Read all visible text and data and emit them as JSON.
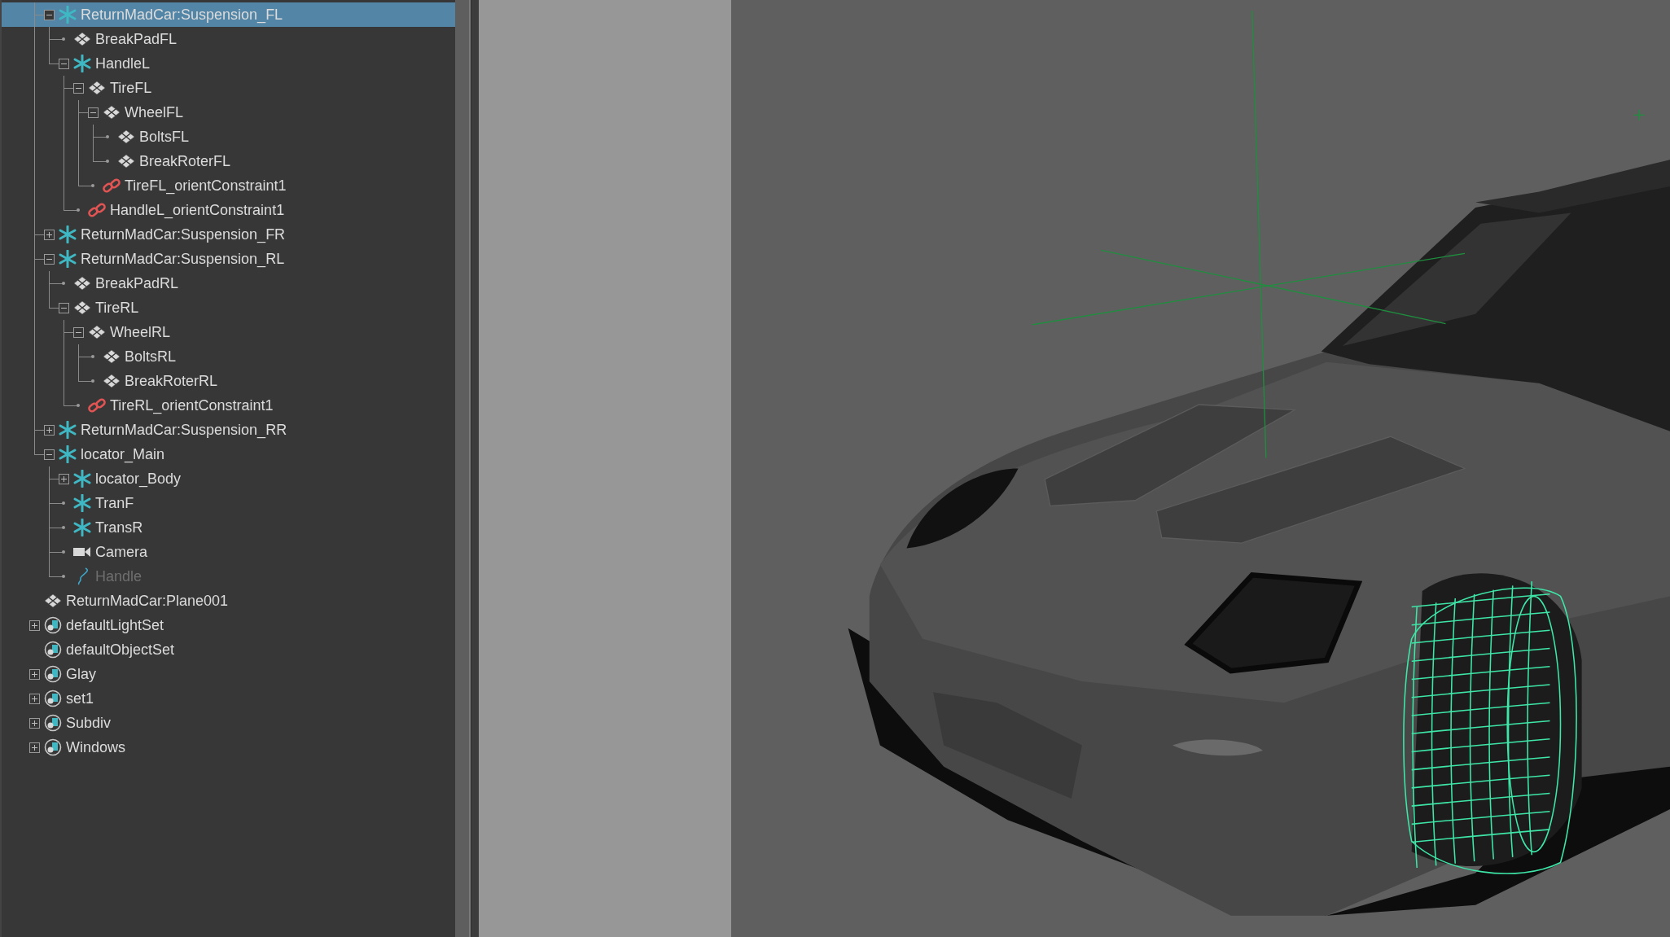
{
  "outliner": {
    "items": [
      {
        "children": [
          {
            "label": "ReturnMadCar:Suspension_FL",
            "kind": "locator",
            "expanded": true,
            "selected": true,
            "hidden": false,
            "children": [
              {
                "label": "BreakPadFL",
                "kind": "mesh",
                "selected": false,
                "hidden": false
              },
              {
                "label": "HandleL",
                "kind": "locator",
                "expanded": true,
                "selected": false,
                "hidden": false,
                "children": [
                  {
                    "label": "TireFL",
                    "kind": "mesh",
                    "expanded": true,
                    "selected": false,
                    "hidden": false,
                    "children": [
                      {
                        "label": "WheelFL",
                        "kind": "mesh",
                        "expanded": true,
                        "selected": false,
                        "hidden": false,
                        "children": [
                          {
                            "label": "BoltsFL",
                            "kind": "mesh",
                            "selected": false,
                            "hidden": false
                          },
                          {
                            "label": "BreakRoterFL",
                            "kind": "mesh",
                            "selected": false,
                            "hidden": false
                          }
                        ]
                      },
                      {
                        "label": "TireFL_orientConstraint1",
                        "kind": "constraint",
                        "selected": false,
                        "hidden": false
                      }
                    ]
                  },
                  {
                    "label": "HandleL_orientConstraint1",
                    "kind": "constraint",
                    "selected": false,
                    "hidden": false
                  }
                ]
              }
            ]
          },
          {
            "label": "ReturnMadCar:Suspension_FR",
            "kind": "locator",
            "expanded": false,
            "selected": false,
            "hidden": false
          },
          {
            "label": "ReturnMadCar:Suspension_RL",
            "kind": "locator",
            "expanded": true,
            "selected": false,
            "hidden": false,
            "children": [
              {
                "label": "BreakPadRL",
                "kind": "mesh",
                "selected": false,
                "hidden": false
              },
              {
                "label": "TireRL",
                "kind": "mesh",
                "expanded": true,
                "selected": false,
                "hidden": false,
                "children": [
                  {
                    "label": "WheelRL",
                    "kind": "mesh",
                    "expanded": true,
                    "selected": false,
                    "hidden": false,
                    "children": [
                      {
                        "label": "BoltsRL",
                        "kind": "mesh",
                        "selected": false,
                        "hidden": false
                      },
                      {
                        "label": "BreakRoterRL",
                        "kind": "mesh",
                        "selected": false,
                        "hidden": false
                      }
                    ]
                  },
                  {
                    "label": "TireRL_orientConstraint1",
                    "kind": "constraint",
                    "selected": false,
                    "hidden": false
                  }
                ]
              }
            ]
          },
          {
            "label": "ReturnMadCar:Suspension_RR",
            "kind": "locator",
            "expanded": false,
            "selected": false,
            "hidden": false
          },
          {
            "label": "locator_Main",
            "kind": "locator",
            "expanded": true,
            "selected": false,
            "hidden": false,
            "children": [
              {
                "label": "locator_Body",
                "kind": "locator",
                "expanded": false,
                "selected": false,
                "hidden": false
              },
              {
                "label": "TranF",
                "kind": "locator",
                "selected": false,
                "hidden": false
              },
              {
                "label": "TransR",
                "kind": "locator",
                "selected": false,
                "hidden": false
              },
              {
                "label": "Camera",
                "kind": "camera",
                "selected": false,
                "hidden": false
              },
              {
                "label": "Handle",
                "kind": "curve",
                "selected": false,
                "hidden": true
              }
            ]
          }
        ]
      },
      {
        "label": "ReturnMadCar:Plane001",
        "kind": "mesh",
        "selected": false,
        "hidden": false
      },
      {
        "label": "defaultLightSet",
        "kind": "set",
        "expanded": false,
        "selected": false,
        "hidden": false
      },
      {
        "label": "defaultObjectSet",
        "kind": "set",
        "selected": false,
        "hidden": false
      },
      {
        "label": "Glay",
        "kind": "set",
        "expanded": false,
        "selected": false,
        "hidden": false
      },
      {
        "label": "set1",
        "kind": "set",
        "expanded": false,
        "selected": false,
        "hidden": false
      },
      {
        "label": "Subdiv",
        "kind": "set",
        "expanded": false,
        "selected": false,
        "hidden": false
      },
      {
        "label": "Windows",
        "kind": "set",
        "expanded": false,
        "selected": false,
        "hidden": false
      }
    ]
  }
}
